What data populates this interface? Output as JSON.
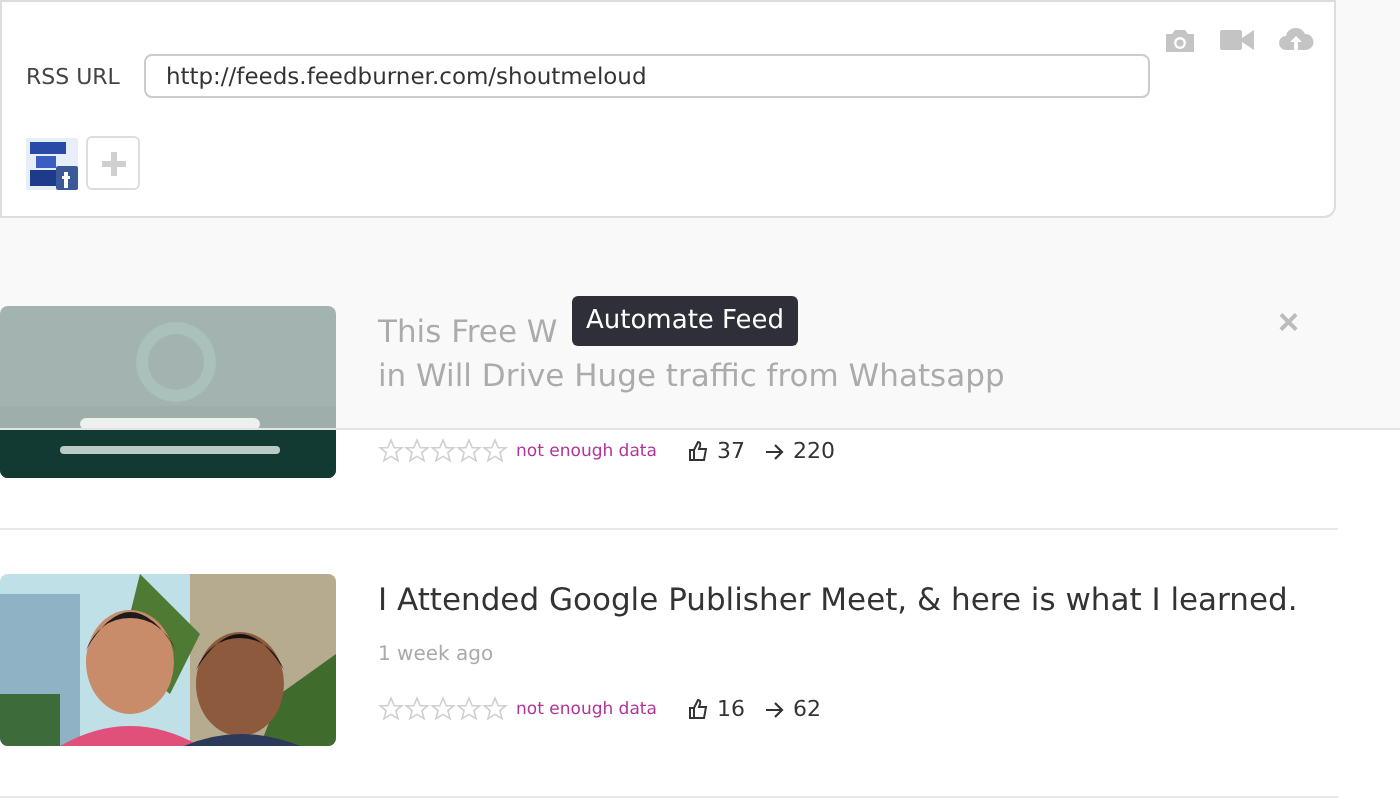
{
  "composer": {
    "rss_label": "RSS URL",
    "rss_value": "http://feeds.feedburner.com/shoutmeloud",
    "tooltip": "Automate Feed",
    "close": "×"
  },
  "posts": [
    {
      "title_before": "This Free W",
      "title_after": "in Will Drive Huge traffic from Whatsapp",
      "stars": 0,
      "rating_note": "not enough data",
      "likes": "37",
      "shares": "220"
    },
    {
      "title_before": "I Attended Google Publisher Meet, & here is what I learned.",
      "time": "1 week ago",
      "stars": 0,
      "rating_note": "not enough data",
      "likes": "16",
      "shares": "62"
    }
  ]
}
